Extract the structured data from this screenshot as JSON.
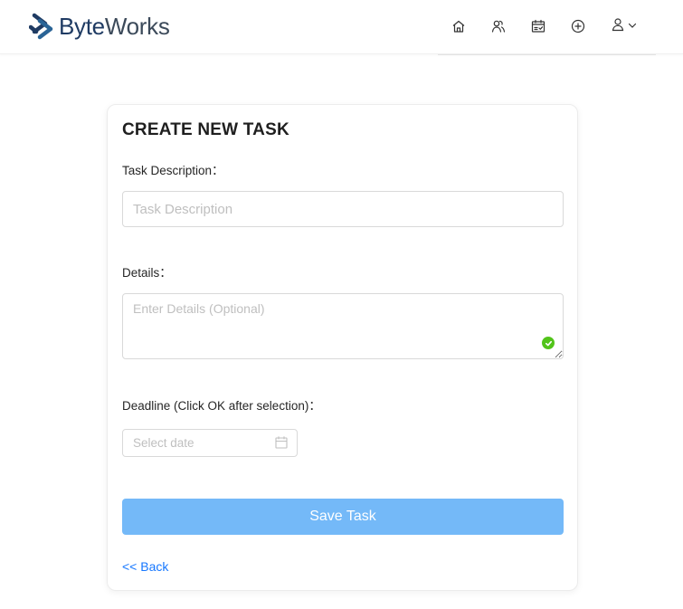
{
  "header": {
    "logo": {
      "icon": "byteworks-logo-icon",
      "text_part1": "Byte",
      "text_part2": "Works",
      "color_primary": "#1f3b63"
    },
    "nav": [
      {
        "name": "home-icon"
      },
      {
        "name": "team-icon"
      },
      {
        "name": "tasks-calendar-icon"
      },
      {
        "name": "add-circle-icon"
      },
      {
        "name": "user-icon"
      }
    ]
  },
  "form": {
    "title": "CREATE NEW TASK",
    "task_description": {
      "label": "Task Description：",
      "placeholder": "Task Description",
      "value": ""
    },
    "details": {
      "label": "Details：",
      "placeholder": "Enter Details (Optional)",
      "value": "",
      "validated": true,
      "status_color": "#52c41a"
    },
    "deadline": {
      "label": "Deadline (Click OK after selection)：",
      "placeholder": "Select date",
      "value": ""
    },
    "save_button": {
      "label": "Save Task",
      "color": "#74b9f8"
    },
    "back_link": {
      "label": "<< Back",
      "color": "#1677ff"
    }
  }
}
